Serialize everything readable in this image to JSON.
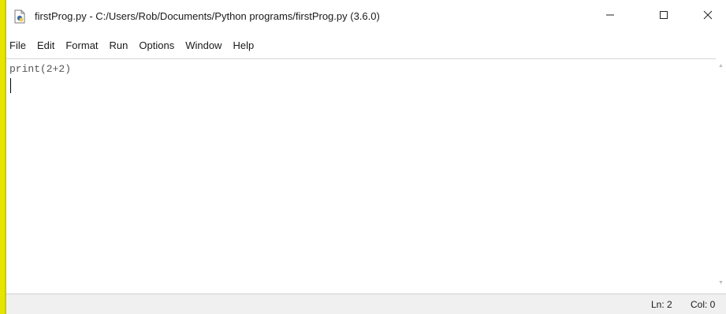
{
  "window": {
    "title": "firstProg.py - C:/Users/Rob/Documents/Python programs/firstProg.py (3.6.0)",
    "icon": "python-file-icon"
  },
  "controls": {
    "minimize_icon": "minimize-icon",
    "maximize_icon": "maximize-icon",
    "close_icon": "close-icon"
  },
  "menu": {
    "items": [
      "File",
      "Edit",
      "Format",
      "Run",
      "Options",
      "Window",
      "Help"
    ]
  },
  "editor": {
    "lines": [
      "print(2+2)",
      ""
    ]
  },
  "status": {
    "line": "Ln: 2",
    "col": "Col: 0"
  },
  "colors": {
    "background_highlight": "#e5e500",
    "code_text": "#555555"
  }
}
